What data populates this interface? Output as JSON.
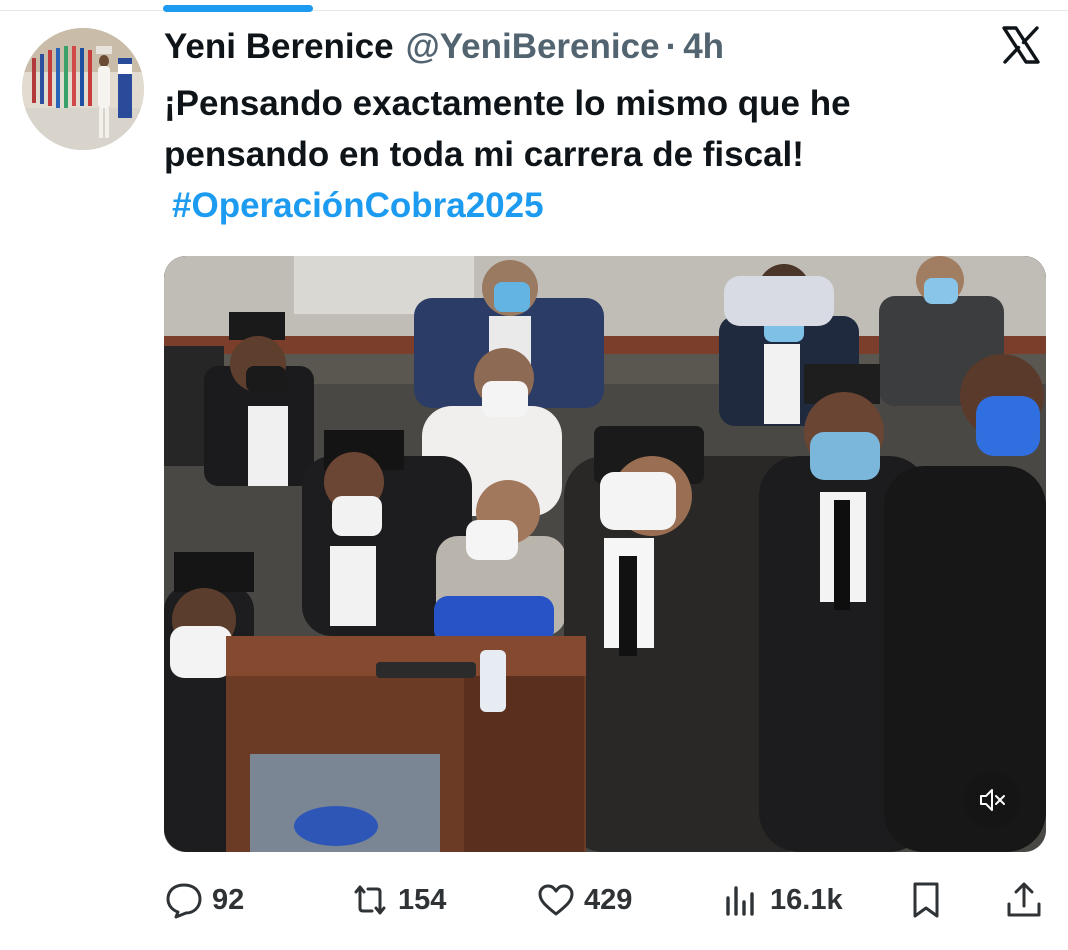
{
  "tweet": {
    "author_name": "Yeni Berenice",
    "handle": "@YeniBerenice",
    "separator": "·",
    "time": "4h",
    "text": "¡Pensando exactamente lo mismo que he pensando en toda mi carrera de fiscal!",
    "hashtag": "#OperaciónCobra2025"
  },
  "media": {
    "type": "video",
    "muted": true
  },
  "actions": {
    "replies": "92",
    "retweets": "154",
    "likes": "429",
    "views": "16.1k"
  },
  "colors": {
    "accent": "#1d9bf0",
    "text": "#0f1419",
    "secondary": "#536471"
  },
  "icons": [
    "x-logo-icon",
    "mute-icon",
    "reply-icon",
    "retweet-icon",
    "like-icon",
    "views-icon",
    "bookmark-icon",
    "share-icon"
  ]
}
